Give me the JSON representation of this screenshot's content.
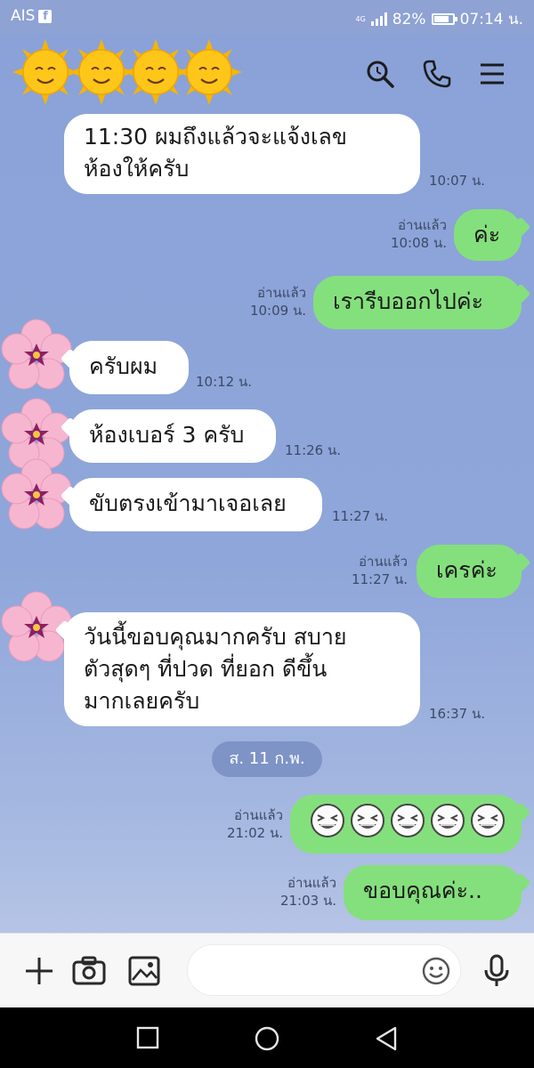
{
  "status_bar": {
    "carrier": "AIS",
    "carrier_badge": "f",
    "network": "4G",
    "battery": "82%",
    "battery_level": 0.82,
    "time": "07:14 น."
  },
  "header": {
    "avatar_icons": [
      "sun-face-icon",
      "sun-face-icon",
      "sun-face-icon",
      "sun-face-icon"
    ],
    "actions": [
      "search-icon",
      "phone-icon",
      "menu-icon"
    ]
  },
  "messages": [
    {
      "side": "left",
      "lines": [
        "11:30 ผมถึงแล้วจะแจ้งเลข",
        "ห้องให้ครับ"
      ],
      "time": "10:07 น."
    },
    {
      "side": "right",
      "text": "ค่ะ",
      "read": "อ่านแล้ว",
      "time": "10:08 น."
    },
    {
      "side": "right",
      "text": "เรารีบออกไปค่ะ",
      "read": "อ่านแล้ว",
      "time": "10:09 น."
    },
    {
      "side": "left",
      "text": "ครับผม",
      "time": "10:12 น."
    },
    {
      "side": "left",
      "text": "ห้องเบอร์ 3 ครับ",
      "time": "11:26 น."
    },
    {
      "side": "left",
      "text": "ขับตรงเข้ามาเจอเลย",
      "time": "11:27 น."
    },
    {
      "side": "right",
      "text": "เครค่ะ",
      "read": "อ่านแล้ว",
      "time": "11:27 น."
    },
    {
      "side": "left",
      "lines": [
        "วันนี้ขอบคุณมากครับ สบาย",
        "ตัวสุดๆ ที่ปวด ที่ยอก ดีขึ้น",
        "มากเลยครับ"
      ],
      "time": "16:37 น."
    },
    {
      "side": "right",
      "sticker": "laughing-face-icon",
      "count": 5,
      "read": "อ่านแล้ว",
      "time": "21:02 น."
    },
    {
      "side": "right",
      "text": "ขอบคุณค่ะ..",
      "read": "อ่านแล้ว",
      "time": "21:03 น."
    }
  ],
  "date_divider": "ส. 11 ก.พ.",
  "colors": {
    "background": "#8ea4d8",
    "sent_bubble": "#84e07c",
    "received_bubble": "#ffffff"
  },
  "input_bar": {
    "icons": [
      "plus-icon",
      "camera-icon",
      "image-icon",
      "emoji-icon",
      "microphone-icon"
    ]
  },
  "nav_bar": {
    "icons": [
      "recent-apps-icon",
      "home-icon",
      "back-icon"
    ]
  }
}
